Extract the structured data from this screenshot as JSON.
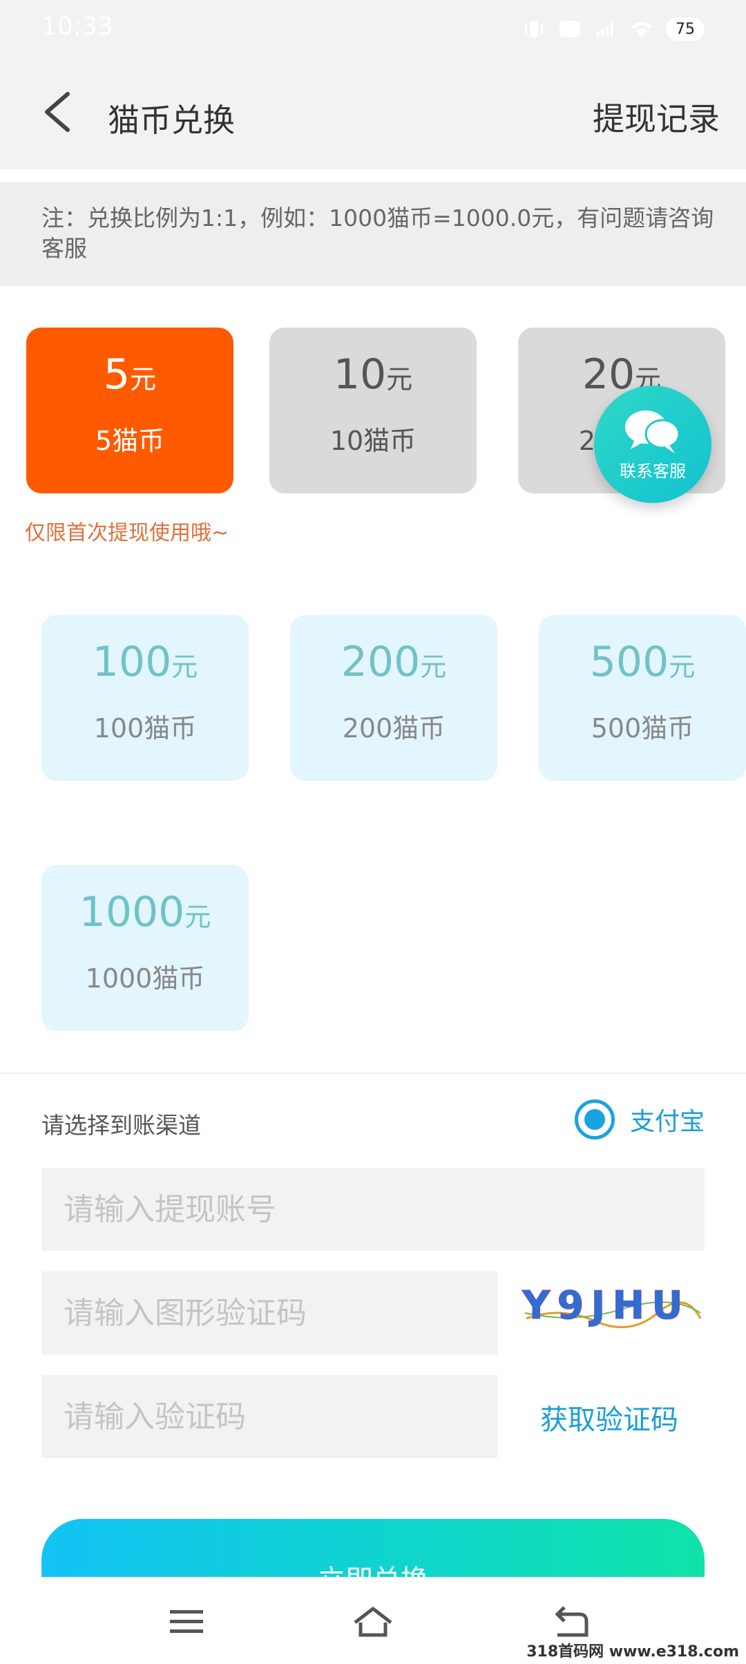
{
  "status_bar": {
    "time": "10:33",
    "battery": "75"
  },
  "header": {
    "title": "猫币兑换",
    "right_link": "提现记录"
  },
  "notice": "注：兑换比例为1:1，例如：1000猫币=1000.0元，有问题请咨询客服",
  "options": [
    {
      "amount": "5",
      "unit": "元",
      "coins": "5猫币"
    },
    {
      "amount": "10",
      "unit": "元",
      "coins": "10猫币"
    },
    {
      "amount": "20",
      "unit": "元",
      "coins": "20猫币"
    },
    {
      "amount": "100",
      "unit": "元",
      "coins": "100猫币"
    },
    {
      "amount": "200",
      "unit": "元",
      "coins": "200猫币"
    },
    {
      "amount": "500",
      "unit": "元",
      "coins": "500猫币"
    },
    {
      "amount": "1000",
      "unit": "元",
      "coins": "1000猫币"
    }
  ],
  "first_note": "仅限首次提现使用哦~",
  "service_button": "联系客服",
  "channel": {
    "label": "请选择到账渠道",
    "option": "支付宝"
  },
  "form": {
    "account_placeholder": "请输入提现账号",
    "captcha_placeholder": "请输入图形验证码",
    "captcha_text": "Y9JHU",
    "code_placeholder": "请输入验证码",
    "get_code": "获取验证码",
    "submit": "立即兑换"
  },
  "watermark": "318首码网 www.e318.com",
  "colors": {
    "accent_orange": "#ff5a00",
    "accent_blue": "#1a9ed8",
    "option_grey": "#dadada",
    "option_blue": "#e3f5fd"
  }
}
